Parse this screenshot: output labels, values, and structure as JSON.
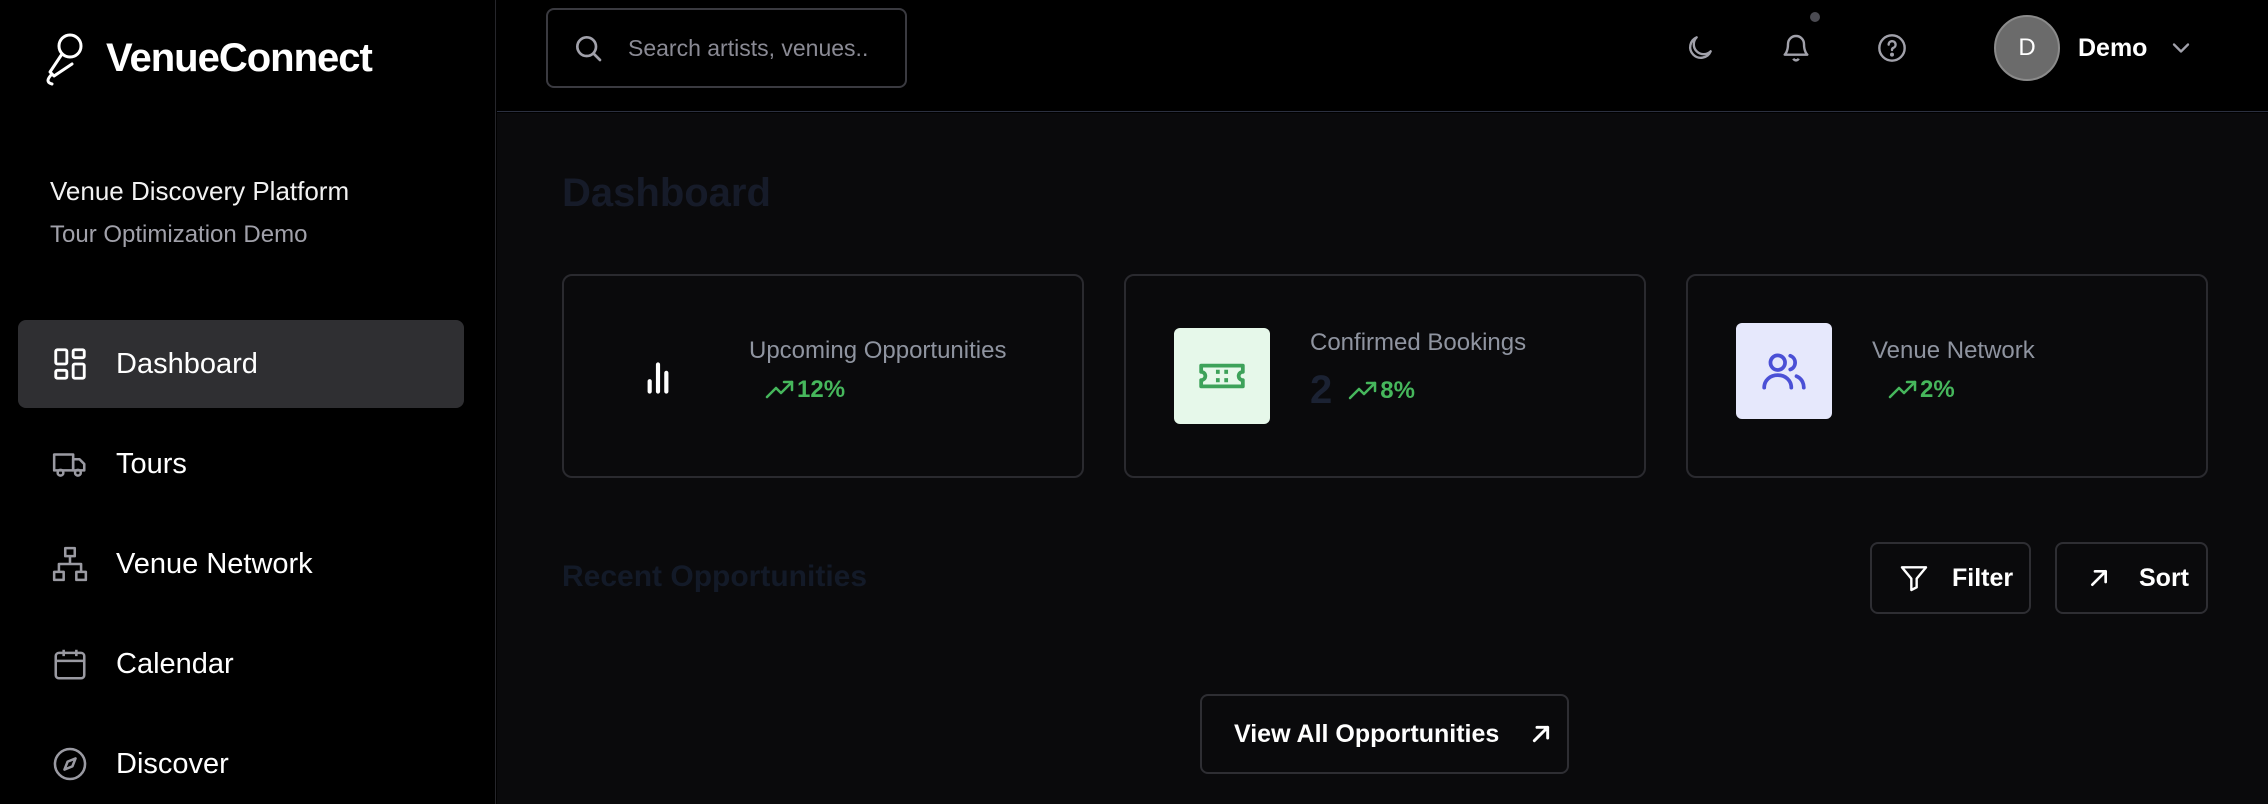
{
  "brand": {
    "name": "VenueConnect"
  },
  "platform": {
    "title": "Venue Discovery Platform",
    "subtitle": "Tour Optimization Demo"
  },
  "sidebar": {
    "items": [
      {
        "label": "Dashboard",
        "icon": "dashboard-icon",
        "active": true
      },
      {
        "label": "Tours",
        "icon": "truck-icon"
      },
      {
        "label": "Venue Network",
        "icon": "network-icon"
      },
      {
        "label": "Calendar",
        "icon": "calendar-icon"
      },
      {
        "label": "Discover",
        "icon": "compass-icon"
      }
    ]
  },
  "header": {
    "search_placeholder": "Search artists, venues...",
    "icons": [
      "moon-icon",
      "bell-icon",
      "help-icon"
    ],
    "user": {
      "initial": "D",
      "name": "Demo"
    }
  },
  "main": {
    "title": "Dashboard",
    "stats": [
      {
        "label": "Upcoming Opportunities",
        "value": "",
        "trend": "12%",
        "icon": "bar-chart-icon"
      },
      {
        "label": "Confirmed Bookings",
        "value": "2",
        "trend": "8%",
        "icon": "ticket-icon"
      },
      {
        "label": "Venue Network",
        "value": "",
        "trend": "2%",
        "icon": "users-icon"
      }
    ],
    "recent_title": "Recent Opportunities",
    "filter_label": "Filter",
    "sort_label": "Sort",
    "view_all_label": "View All Opportunities"
  },
  "colors": {
    "accent_green": "#46b75c",
    "ticket_bg": "#e6f8ea",
    "users_bg": "#e6e8fc",
    "users_fg": "#4b50d6",
    "active_nav_bg": "#2f2f32"
  }
}
